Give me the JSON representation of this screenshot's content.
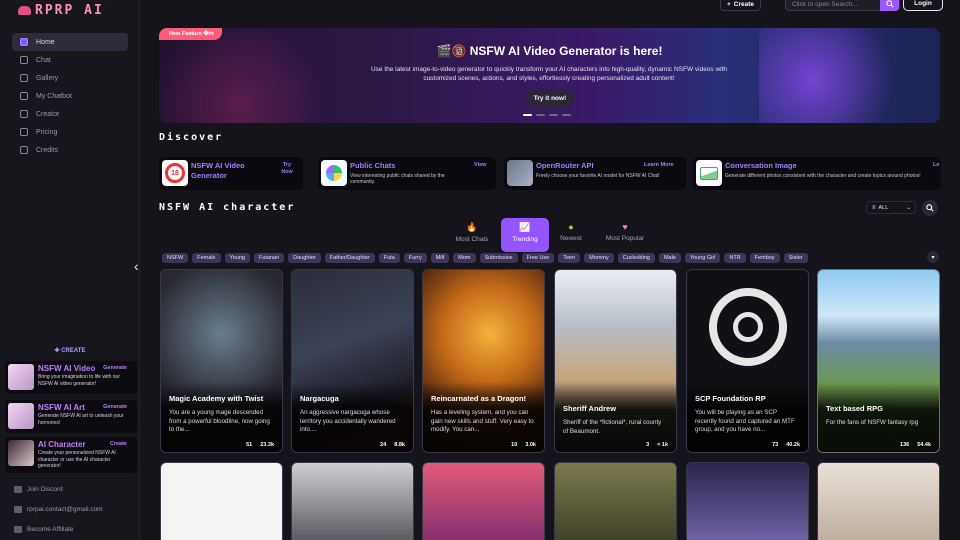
{
  "app": {
    "name": "RPRP AI"
  },
  "sidebar": {
    "nav": [
      {
        "label": "Home",
        "icon": "home-icon"
      },
      {
        "label": "Chat",
        "icon": "chat-icon"
      },
      {
        "label": "Gallery",
        "icon": "gallery-icon"
      },
      {
        "label": "My Chatbot",
        "icon": "bot-icon"
      },
      {
        "label": "Creator",
        "icon": "creator-icon"
      },
      {
        "label": "Pricing",
        "icon": "pricing-icon"
      },
      {
        "label": "Credits",
        "icon": "credits-icon"
      }
    ],
    "create_label": "✚ CREATE",
    "create_cards": [
      {
        "title": "NSFW AI Video",
        "action": "Generate",
        "desc": "Bring your imagination to life with our NSFW AI video generator!"
      },
      {
        "title": "NSFW AI Art",
        "action": "Generate",
        "desc": "Generate NSFW AI art to unleash your hornones!"
      },
      {
        "title": "AI Character",
        "action": "Create",
        "desc": "Create your personalized NSFW AI character or use the AI character generator!"
      }
    ],
    "footer": [
      {
        "label": "Join Discord",
        "icon": "discord-icon"
      },
      {
        "label": "rprpai.contact@gmail.com",
        "icon": "mail-icon"
      },
      {
        "label": "Become Affiliate",
        "icon": "affiliate-icon"
      }
    ]
  },
  "topbar": {
    "create_label": "Create",
    "search_placeholder": "Click to open Search...",
    "login_label": "Login"
  },
  "banner": {
    "badge": "New Feature �in",
    "title": "🎬🔞 NSFW AI Video Generator is here!",
    "desc": "Use the latest image-to-video generator to quickly transform your AI characters into high-quality, dynamic NSFW videos with customized scenes, actions, and styles, effortlessly creating personalized adult content!",
    "button": "Try it now!"
  },
  "discover": {
    "heading": "Discover",
    "items": [
      {
        "title": "NSFW AI Video Generator",
        "desc": "",
        "action": "Try Now"
      },
      {
        "title": "Public Chats",
        "desc": "View interesting public chats shared by the community.",
        "action": "View"
      },
      {
        "title": "OpenRouter API",
        "desc": "Freely choose your favorite AI model for NSFW AI Chat!",
        "action": "Learn More"
      },
      {
        "title": "Conversation Image",
        "desc": "Generate different photos consistent with the character and create topics around photos!",
        "action": "Le"
      }
    ]
  },
  "characters": {
    "heading": "NSFW AI character",
    "filter": "ALL",
    "tabs": [
      {
        "label": "Most Chats",
        "icon": "🔥"
      },
      {
        "label": "Trending",
        "icon": "📈"
      },
      {
        "label": "Newest",
        "icon": "●"
      },
      {
        "label": "Most Popular",
        "icon": "♥"
      }
    ],
    "tags": [
      "NSFW",
      "Female",
      "Young",
      "Futanari",
      "Daughter",
      "Father/Daughter",
      "Futa",
      "Furry",
      "Milf",
      "Mom",
      "Submissive",
      "Free Use",
      "Teen",
      "Mommy",
      "Cuckolding",
      "Male",
      "Young Girl",
      "NTR",
      "Femboy",
      "Sister"
    ],
    "cards": [
      {
        "title": "Magic Academy with Twist",
        "desc": "You are a young mage descended from a powerful bloodline, now going to the...",
        "chats": "51",
        "views": "23.3k"
      },
      {
        "title": "Nargacuga",
        "desc": "An aggressive nargacuga whose territory you accidentally wandered into....",
        "chats": "24",
        "views": "8.8k"
      },
      {
        "title": "Reincarnated as a Dragon!",
        "desc": "Has a leveling system, and you can gain new skills and stuff. Very easy to modify. You can...",
        "chats": "10",
        "views": "3.0k"
      },
      {
        "title": "Sheriff Andrew",
        "desc": "Sheriff of the *fictional*, rural county of Beaumont.",
        "chats": "3",
        "views": "< 1k"
      },
      {
        "title": "SCP Foundation RP",
        "desc": "You will be playing as an SCP recently found and captured an MTF group, and you have no...",
        "chats": "73",
        "views": "40.2k"
      },
      {
        "title": "Text based RPG",
        "desc": "For the fans of NSFW fantasy rpg",
        "chats": "136",
        "views": "54.4k"
      }
    ]
  },
  "colors": {
    "accent": "#9455ff",
    "link": "#a57dff",
    "bg": "#15141b"
  }
}
